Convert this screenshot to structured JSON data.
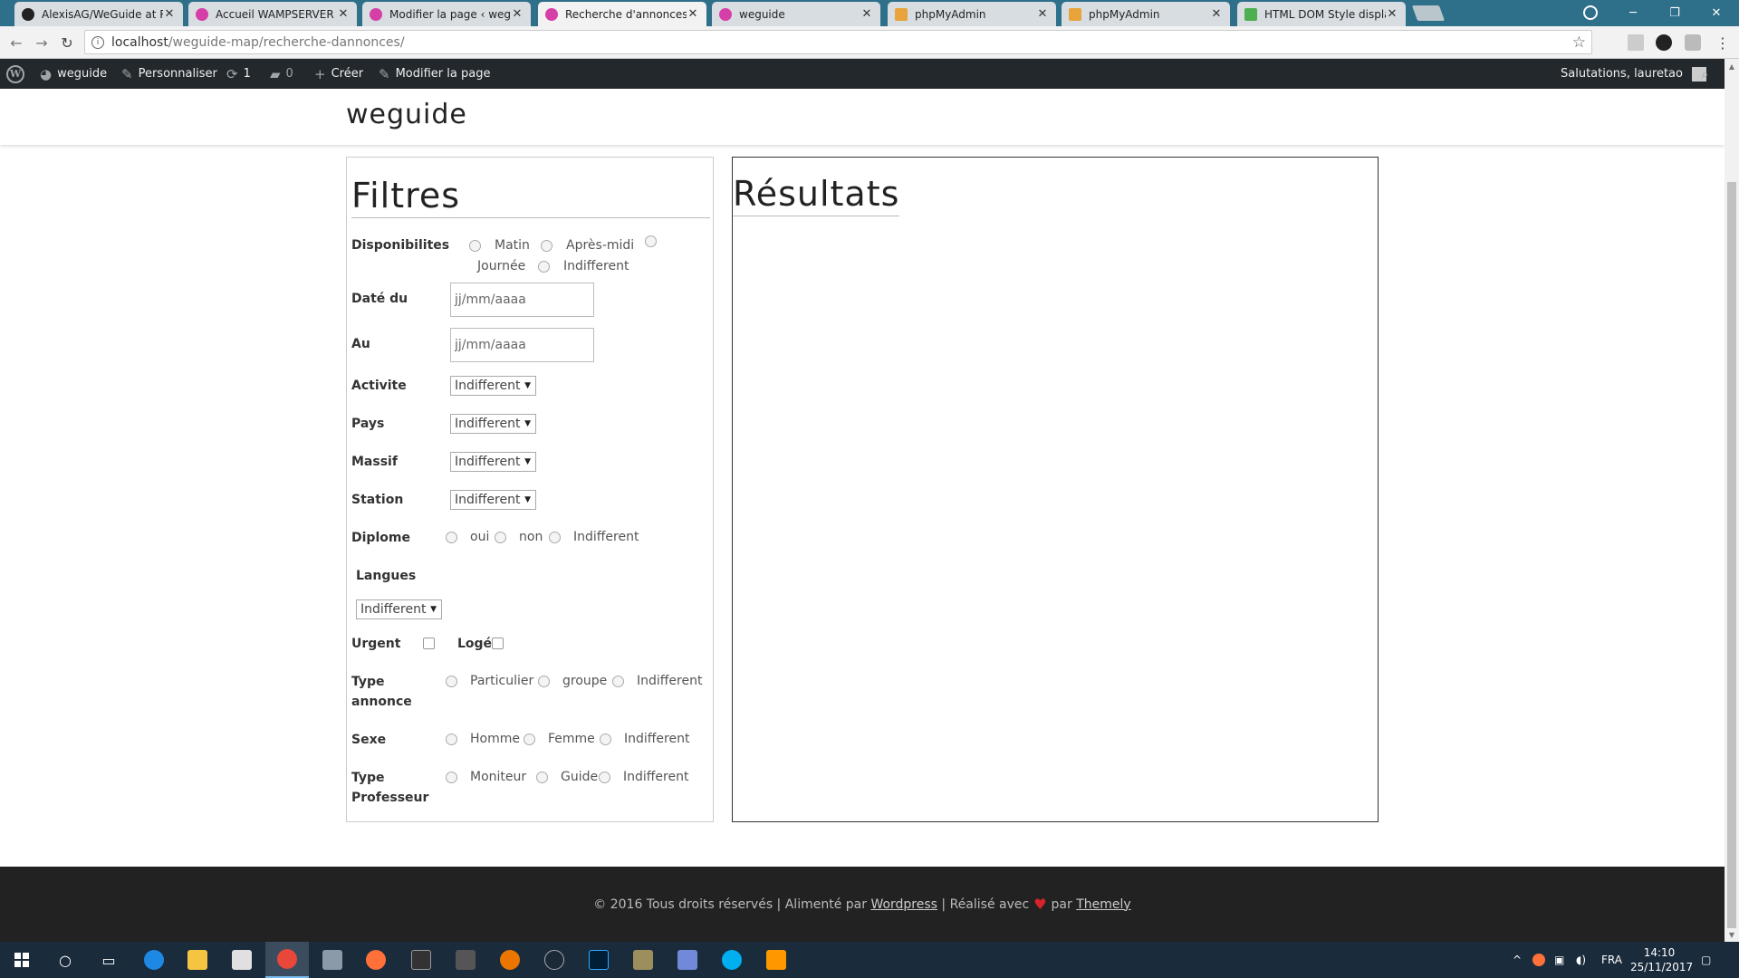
{
  "browser": {
    "tabs": [
      {
        "title": "AlexisAG/WeGuide at Re",
        "icon": "github-icon",
        "active": false
      },
      {
        "title": "Accueil WAMPSERVER",
        "icon": "wordpress-icon",
        "active": false
      },
      {
        "title": "Modifier la page ‹ wegu",
        "icon": "wordpress-icon",
        "active": false
      },
      {
        "title": "Recherche d'annonces –",
        "icon": "wordpress-icon",
        "active": true
      },
      {
        "title": "weguide",
        "icon": "wordpress-icon",
        "active": false
      },
      {
        "title": "phpMyAdmin",
        "icon": "phpmyadmin-icon",
        "active": false
      },
      {
        "title": "phpMyAdmin",
        "icon": "phpmyadmin-icon",
        "active": false
      },
      {
        "title": "HTML DOM Style display",
        "icon": "w3schools-icon",
        "active": false
      }
    ],
    "url_host": "localhost",
    "url_path": "/weguide-map/recherche-dannonces/"
  },
  "adminbar": {
    "site_name": "weguide",
    "customize": "Personnaliser",
    "updates_count": "1",
    "comments_count": "0",
    "new": "Créer",
    "edit_page": "Modifier la page",
    "greeting": "Salutations, lauretao"
  },
  "site": {
    "title": "weguide"
  },
  "filters": {
    "heading": "Filtres",
    "disponibilites": {
      "label": "Disponibilites",
      "options": [
        "Matin",
        "Après-midi",
        "Journée",
        "Indifferent"
      ]
    },
    "date_from": {
      "label": "Daté du",
      "placeholder": "jj/mm/aaaa"
    },
    "date_to": {
      "label": "Au",
      "placeholder": "jj/mm/aaaa"
    },
    "activite": {
      "label": "Activite",
      "value": "Indifferent"
    },
    "pays": {
      "label": "Pays",
      "value": "Indifferent"
    },
    "massif": {
      "label": "Massif",
      "value": "Indifferent"
    },
    "station": {
      "label": "Station",
      "value": "Indifferent"
    },
    "diplome": {
      "label": "Diplome",
      "options": [
        "oui",
        "non",
        "Indifferent"
      ]
    },
    "langues": {
      "label": "Langues",
      "value": "Indifferent"
    },
    "urgent": {
      "label": "Urgent"
    },
    "loge": {
      "label": "Logé"
    },
    "type_annonce": {
      "label_line1": "Type",
      "label_line2": "annonce",
      "options": [
        "Particulier",
        "groupe",
        "Indifferent"
      ]
    },
    "sexe": {
      "label": "Sexe",
      "options": [
        "Homme",
        "Femme",
        "Indifferent"
      ]
    },
    "type_professeur": {
      "label_line1": "Type",
      "label_line2": "Professeur",
      "options": [
        "Moniteur",
        "Guide",
        "Indifferent"
      ]
    }
  },
  "results": {
    "heading": "Résultats"
  },
  "footer": {
    "copyright": "© 2016 Tous droits réservés | Alimenté par",
    "wordpress_link": "Wordpress",
    "made_with": "| Réalisé avec",
    "by": "par",
    "themely_link": "Themely"
  },
  "taskbar": {
    "language": "FRA",
    "time": "14:10",
    "date": "25/11/2017"
  },
  "colors": {
    "admin_bar": "#23282d",
    "footer": "#222222",
    "tab_strip": "#2e6f8a",
    "heart": "#d8232a"
  }
}
